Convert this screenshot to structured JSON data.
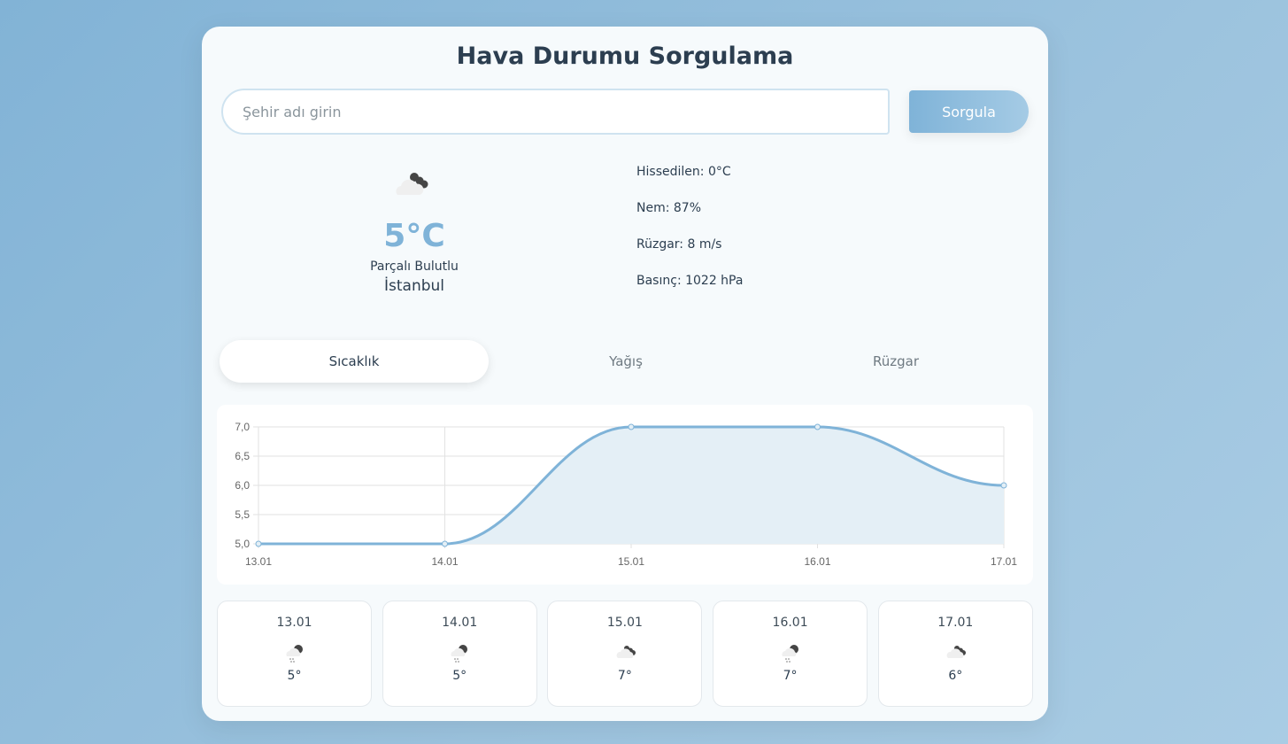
{
  "title": "Hava Durumu Sorgulama",
  "search": {
    "placeholder": "Şehir adı girin",
    "button": "Sorgula"
  },
  "current": {
    "icon": "partly-cloudy-icon",
    "temp": "5°C",
    "description": "Parçalı Bulutlu",
    "city": "İstanbul"
  },
  "details": [
    "Hissedilen: 0°C",
    "Nem: 87%",
    "Rüzgar: 8 m/s",
    "Basınç: 1022 hPa"
  ],
  "tabs": [
    {
      "label": "Sıcaklık",
      "active": true
    },
    {
      "label": "Yağış"
    },
    {
      "label": "Rüzgar"
    }
  ],
  "chart_data": {
    "type": "line",
    "categories": [
      "13.01",
      "14.01",
      "15.01",
      "16.01",
      "17.01"
    ],
    "values": [
      5,
      5,
      7,
      7,
      6
    ],
    "ylim": [
      5,
      7
    ],
    "yticks": [
      "5,0",
      "5,5",
      "6,0",
      "6,5",
      "7,0"
    ],
    "color": "#7fb3d8",
    "fill": "#e4eff6",
    "grid": true
  },
  "forecast": [
    {
      "date": "13.01",
      "icon": "snow-rain-icon",
      "temp": "5°"
    },
    {
      "date": "14.01",
      "icon": "snow-rain-icon",
      "temp": "5°"
    },
    {
      "date": "15.01",
      "icon": "partly-cloudy-icon",
      "temp": "7°"
    },
    {
      "date": "16.01",
      "icon": "snow-rain-icon",
      "temp": "7°"
    },
    {
      "date": "17.01",
      "icon": "partly-cloudy-icon",
      "temp": "6°"
    }
  ]
}
